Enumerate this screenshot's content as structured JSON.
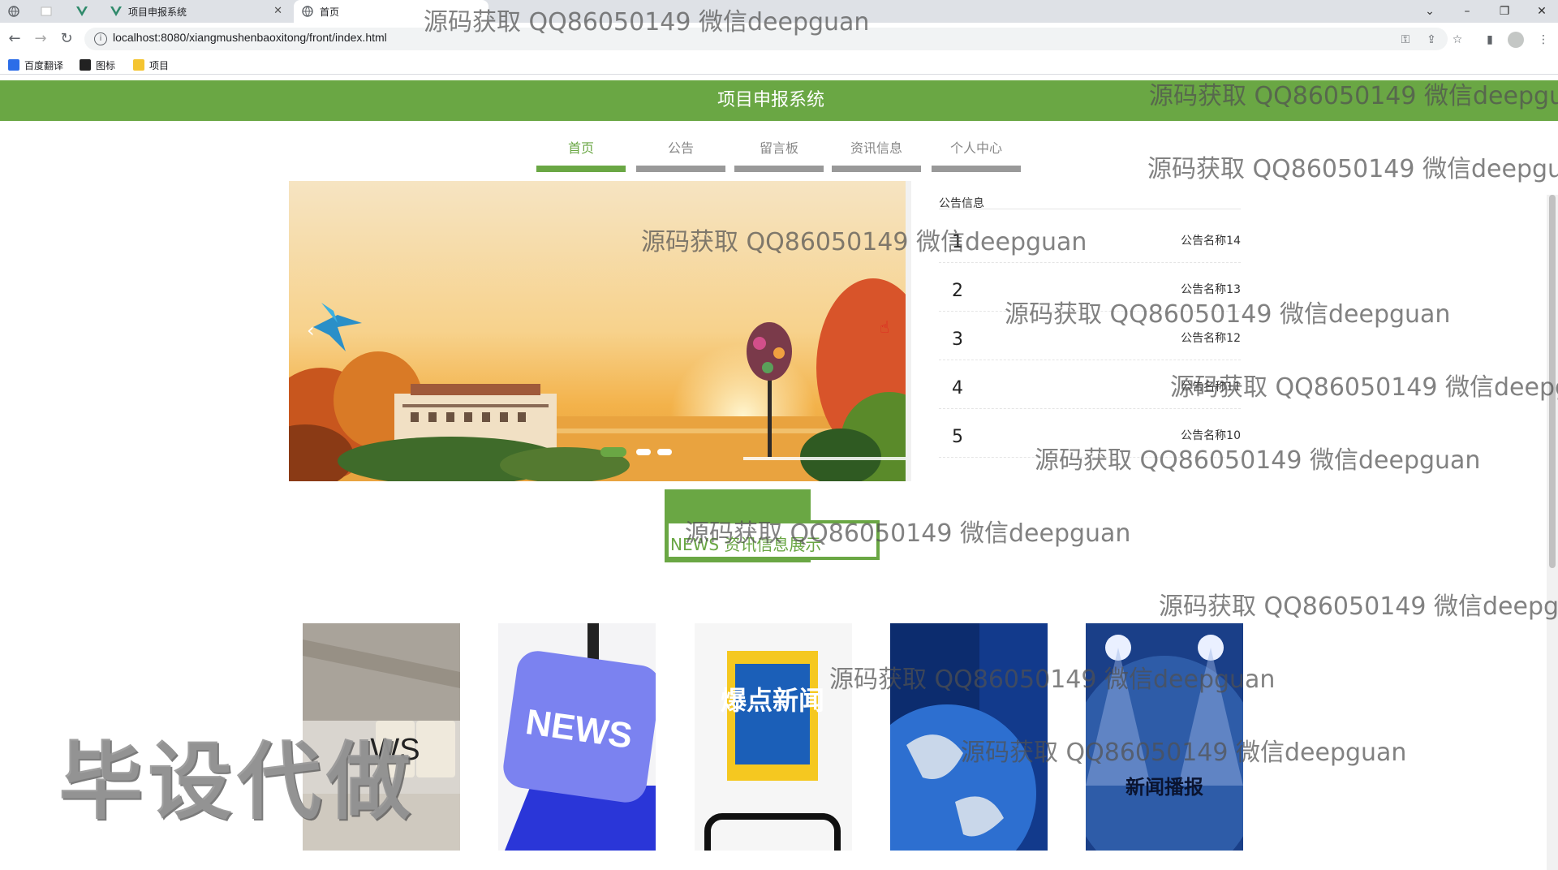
{
  "browser": {
    "tabs": [
      {
        "label": ""
      },
      {
        "label": ""
      },
      {
        "label": ""
      },
      {
        "label": "项目申报系统"
      },
      {
        "label": "首页"
      }
    ],
    "url": "localhost:8080/xiangmushenbaoxitong/front/index.html",
    "bookmarks": [
      {
        "label": "百度翻译"
      },
      {
        "label": "图标"
      },
      {
        "label": "项目"
      }
    ]
  },
  "site": {
    "title": "项目申报系统",
    "nav": [
      {
        "label": "首页",
        "active": true
      },
      {
        "label": "公告",
        "active": false
      },
      {
        "label": "留言板",
        "active": false
      },
      {
        "label": "资讯信息",
        "active": false
      },
      {
        "label": "个人中心",
        "active": false
      }
    ],
    "banner": {
      "prev_label": "‹",
      "active_dot": 0,
      "dot_count": 3
    },
    "notices": {
      "heading": "公告信息",
      "items": [
        {
          "num": "1",
          "title": "公告名称14"
        },
        {
          "num": "2",
          "title": "公告名称13"
        },
        {
          "num": "3",
          "title": "公告名称12"
        },
        {
          "num": "4",
          "title": "公告名称11"
        },
        {
          "num": "5",
          "title": "公告名称10"
        }
      ]
    },
    "news": {
      "title": "NEWS 资讯信息展示",
      "cards": [
        {
          "caption": "WS"
        },
        {
          "caption": "NEWS"
        },
        {
          "caption": "爆点新闻"
        },
        {
          "caption": ""
        },
        {
          "caption": "新闻播报"
        }
      ]
    }
  },
  "overlays": {
    "watermark": "源码获取 QQ86050149 微信deepguan",
    "watermark_cut1": "源码获取 QQ86050149 微信deepgu",
    "watermark_cut2": "源码获取 QQ86050149 微信deepgua",
    "watermark_cut3": "源码获取 QQ86050149 微信deepg",
    "big_stamp": "毕设代做"
  }
}
